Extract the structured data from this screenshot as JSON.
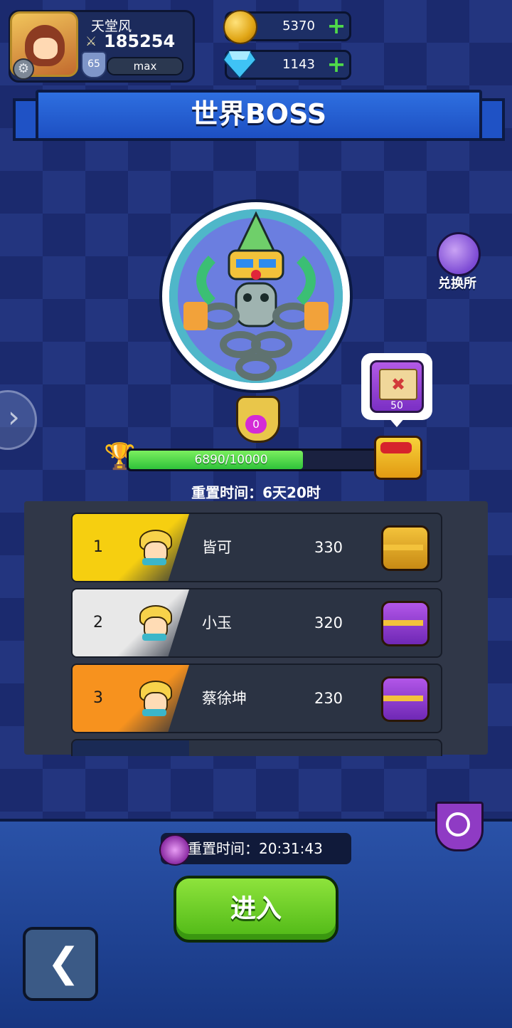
{
  "player": {
    "name": "天堂风",
    "power": "185254",
    "level": "65",
    "level_bar": "max"
  },
  "currency": {
    "gold": "5370",
    "gems": "1143"
  },
  "banner": {
    "title": "世界BOSS"
  },
  "exchange": {
    "label": "兑换所"
  },
  "boss": {
    "kill_count": "0",
    "reward_qty": "50"
  },
  "progress": {
    "text": "6890/10000",
    "value": 6890,
    "max": 10000
  },
  "reset_time_1": "重置时间：6天20时",
  "leaderboard": [
    {
      "rank": "1",
      "name": "皆可",
      "score": "330",
      "rank_color": "#f6cf10",
      "chest": "gold"
    },
    {
      "rank": "2",
      "name": "小玉",
      "score": "320",
      "rank_color": "#e8e8e8",
      "chest": "purple"
    },
    {
      "rank": "3",
      "name": "蔡徐坤",
      "score": "230",
      "rank_color": "#f7921e",
      "chest": "purple"
    }
  ],
  "reset_time_2": "重置时间：20:31:43",
  "enter_button": "进入",
  "colors": {
    "accent_green": "#4fb816",
    "banner_blue": "#2e6fe0",
    "gold_chest": "#f3c23b",
    "purple_chest": "#9c35d6"
  }
}
